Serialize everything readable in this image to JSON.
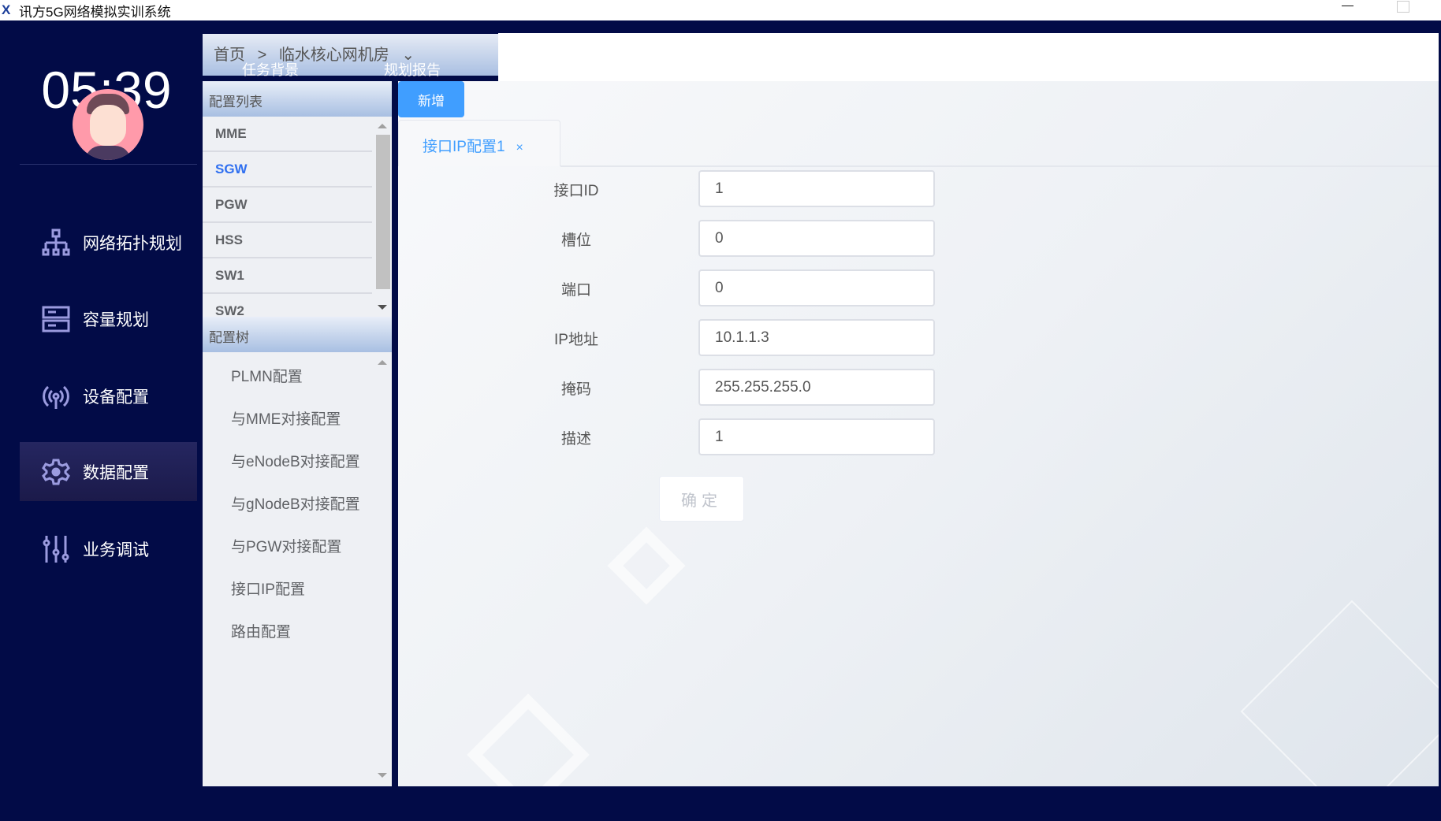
{
  "window": {
    "title": "讯方5G网络模拟实训系统",
    "logo": "X"
  },
  "sidebar": {
    "clock": "05:39",
    "items": [
      {
        "label": "网络拓扑规划",
        "icon": "topology-icon"
      },
      {
        "label": "容量规划",
        "icon": "server-icon"
      },
      {
        "label": "设备配置",
        "icon": "signal-icon"
      },
      {
        "label": "数据配置",
        "icon": "gear-icon",
        "active": true
      },
      {
        "label": "业务调试",
        "icon": "sliders-icon"
      }
    ]
  },
  "header": {
    "breadcrumb": [
      "首页",
      ">",
      "临水核心网机房"
    ],
    "buttons": [
      "任务背景",
      "规划报告"
    ]
  },
  "config_list": {
    "title": "配置列表",
    "items": [
      "MME",
      "SGW",
      "PGW",
      "HSS",
      "SW1",
      "SW2"
    ],
    "selected": "SGW"
  },
  "config_tree": {
    "title": "配置树",
    "items": [
      "PLMN配置",
      "与MME对接配置",
      "与eNodeB对接配置",
      "与gNodeB对接配置",
      "与PGW对接配置",
      "接口IP配置",
      "路由配置"
    ]
  },
  "main": {
    "new_label": "新增",
    "tab_label": "接口IP配置1",
    "tab_close": "×",
    "fields": [
      {
        "label": "接口ID",
        "value": "1"
      },
      {
        "label": "槽位",
        "value": "0"
      },
      {
        "label": "端口",
        "value": "0"
      },
      {
        "label": "IP地址",
        "value": "10.1.1.3"
      },
      {
        "label": "掩码",
        "value": "255.255.255.0"
      },
      {
        "label": "描述",
        "value": "1"
      }
    ],
    "confirm_label": "确定"
  },
  "colors": {
    "sidebar": "#020b47",
    "accent": "#409eff"
  }
}
